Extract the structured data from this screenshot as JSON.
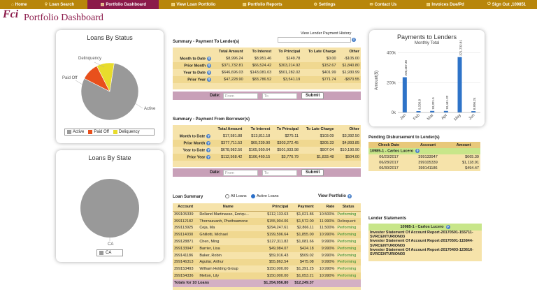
{
  "nav": {
    "items": [
      {
        "label": "Home",
        "icon": "home-icon",
        "glyph": "⌂",
        "w": 35
      },
      {
        "label": "Loan Search",
        "icon": "search-icon",
        "glyph": "⚲",
        "w": 82
      },
      {
        "label": "Portfolio Dashboard",
        "icon": "dashboard-icon",
        "glyph": "▤",
        "w": 103,
        "active": true
      },
      {
        "label": "View Loan Portfolio",
        "icon": "portfolio-icon",
        "glyph": "▤",
        "w": 100
      },
      {
        "label": "Portfolio Reports",
        "icon": "reports-icon",
        "glyph": "▤",
        "w": 100
      },
      {
        "label": "Settings",
        "icon": "settings-icon",
        "glyph": "⚙",
        "w": 80
      },
      {
        "label": "Contact Us",
        "icon": "contact-icon",
        "glyph": "✉",
        "w": 90
      },
      {
        "label": "Invoices Due/Pd",
        "icon": "invoice-icon",
        "glyph": "▤",
        "w": 90
      },
      {
        "label": "Sign Out ,109851",
        "icon": "signout-icon",
        "glyph": "⏻",
        "w": 88
      }
    ],
    "bg": "#b8860b",
    "active_bg": "#8b1a4a"
  },
  "logo": "Fci",
  "page_title": "Portfolio Dashboard",
  "status_chart": {
    "title": "Loans By Status",
    "labels": {
      "active": "Active",
      "paid_off": "Paid Off",
      "delinquency": "Delinquency"
    },
    "legend": [
      "Active",
      "Paid Off",
      "Deliquency"
    ],
    "colors": [
      "#999999",
      "#e8501c",
      "#e8dc2c"
    ]
  },
  "state_chart": {
    "title": "Loans By State",
    "label": "CA",
    "legend": "CA"
  },
  "payment_chart": {
    "title": "Payments to Lenders",
    "subtitle": "Monthly Total",
    "ylabel": "Amount($)",
    "yticks": [
      "0k",
      "200k",
      "400k"
    ]
  },
  "chart_data": [
    {
      "type": "pie",
      "title": "Loans By Status",
      "categories": [
        "Active",
        "Paid Off",
        "Deliquency"
      ],
      "values": [
        8,
        1,
        1
      ]
    },
    {
      "type": "pie",
      "title": "Loans By State",
      "categories": [
        "CA"
      ],
      "values": [
        10
      ]
    },
    {
      "type": "bar",
      "title": "Payments to Lenders",
      "subtitle": "Monthly Total",
      "ylabel": "Amount($)",
      "categories": [
        "Jan",
        "Feb",
        "Mar",
        "Apr",
        "May",
        "Jun"
      ],
      "values": [
        236467.36,
        9336.8,
        10321.5,
        10441.32,
        371732.81,
        8996.24
      ],
      "value_labels": [
        "236,467.36",
        "9,336.8",
        "10,321.5",
        "10,441.32",
        "371,732.81",
        "8,996.24"
      ],
      "ylim": [
        0,
        450000
      ],
      "color": "#2e73c8"
    }
  ],
  "summary_lender": {
    "title": "Summary - Payment To Lender(s)",
    "link": "View Lender Payment History",
    "headers": [
      "",
      "Total Amount",
      "To Interest",
      "To Principal",
      "To Late Charge",
      "Other"
    ],
    "rows": [
      [
        "Month to Date",
        "$8,996.24",
        "$8,951.46",
        "$149.78",
        "$0.00",
        "-$105.00"
      ],
      [
        "Prior Month",
        "$371,732.81",
        "$66,524.42",
        "$303,214.92",
        "$152.67",
        "$1,840.80"
      ],
      [
        "Year to Date",
        "$646,696.03",
        "$143,081.03",
        "$501,282.02",
        "$401.99",
        "$1,930.99"
      ],
      [
        "Prior Year",
        "$47,228.90",
        "$83,786.52",
        "$3,541.19",
        "$771.74",
        "-$870.55"
      ]
    ],
    "date_label": "Date:",
    "from": "From",
    "to": "To",
    "submit": "Submit"
  },
  "summary_borrower": {
    "title": "Summary - Payment From Borrower(s)",
    "headers": [
      "",
      "Total Amount",
      "To Interest",
      "To Principal",
      "To Late Charge",
      "Other"
    ],
    "rows": [
      [
        "Month to Date",
        "$17,581.88",
        "$13,811.18",
        "$275.11",
        "$103.09",
        "$3,392.50"
      ],
      [
        "Prior Month",
        "$377,711.53",
        "$69,239.90",
        "$303,272.45",
        "$305.33",
        "$4,893.85"
      ],
      [
        "Year to Date",
        "$678,982.56",
        "$165,950.64",
        "$501,933.98",
        "$907.04",
        "$10,190.90"
      ],
      [
        "Prior Year",
        "$112,568.42",
        "$106,460.15",
        "$3,770.79",
        "$1,833.48",
        "$504.00"
      ]
    ],
    "date_label": "Date:",
    "from": "From",
    "to": "To",
    "submit": "Submit"
  },
  "loan_summary": {
    "title": "Loan Summary",
    "radio_all": "All Loans",
    "radio_active": "Active Loans",
    "view": "View Portfolio",
    "headers": [
      "Account",
      "Name",
      "Principal",
      "Payment",
      "Rate",
      "Status"
    ],
    "rows": [
      [
        "399105339",
        "Rolland Martinasso, Enriqu...",
        "$112,133.63",
        "$1,021.86",
        "10.500%",
        "Performing"
      ],
      [
        "399112182",
        "Thornsavanh, Phethsamone",
        "$155,904.06",
        "$1,572.00",
        "11.990%",
        "Delinquent"
      ],
      [
        "399113925",
        "Ceja, Ma",
        "$294,247.61",
        "$2,866.11",
        "11.500%",
        "Performing"
      ],
      [
        "399114030",
        "Ghillotti, Michael",
        "$199,596.64",
        "$1,855.00",
        "10.990%",
        "Performing"
      ],
      [
        "399128871",
        "Chen, Ming",
        "$127,311.82",
        "$1,081.66",
        "9.990%",
        "Performing"
      ],
      [
        "399133947",
        "Barrier, Lisa",
        "$49,984.07",
        "$424.18",
        "9.990%",
        "Performing"
      ],
      [
        "399141186",
        "Baker, Robin",
        "$59,916.43",
        "$509.02",
        "9.990%",
        "Performing"
      ],
      [
        "399146313",
        "Aguilar, Arthur",
        "$55,862.54",
        "$475.08",
        "9.990%",
        "Performing"
      ],
      [
        "399153493",
        "Wilham Holding Group",
        "$150,000.00",
        "$1,391.25",
        "10.990%",
        "Performing"
      ],
      [
        "399154336",
        "Melton, Lily",
        "$150,000.00",
        "$1,053.21",
        "10.990%",
        "Performing"
      ]
    ],
    "totals_label": "Totals for 10 Loans",
    "totals_principal": "$1,354,956.80",
    "totals_payment": "$12,249.37"
  },
  "pending": {
    "title": "Pending Disbursement to Lender(s)",
    "headers": [
      "Check Date",
      "Account",
      "Amount"
    ],
    "group": "10985-1 - Carlos Lucero",
    "rows": [
      [
        "06/23/2017",
        "399133947",
        "$665.39"
      ],
      [
        "06/28/2017",
        "399105339",
        "$1,118.91"
      ],
      [
        "06/30/2017",
        "399141186",
        "$494.47"
      ]
    ]
  },
  "statements": {
    "title": "Lender Statements",
    "group": "10985-1 - Carlos Lucero",
    "items": [
      "Investor Statement Of Account Report-20170501-155711-SVRCENTURION03",
      "Investor Statement Of Account Report-20170501-115844-SVRCENTURION03",
      "Investor Statement Of Account Report-20170403-123616-SVRCENTURION03"
    ]
  }
}
